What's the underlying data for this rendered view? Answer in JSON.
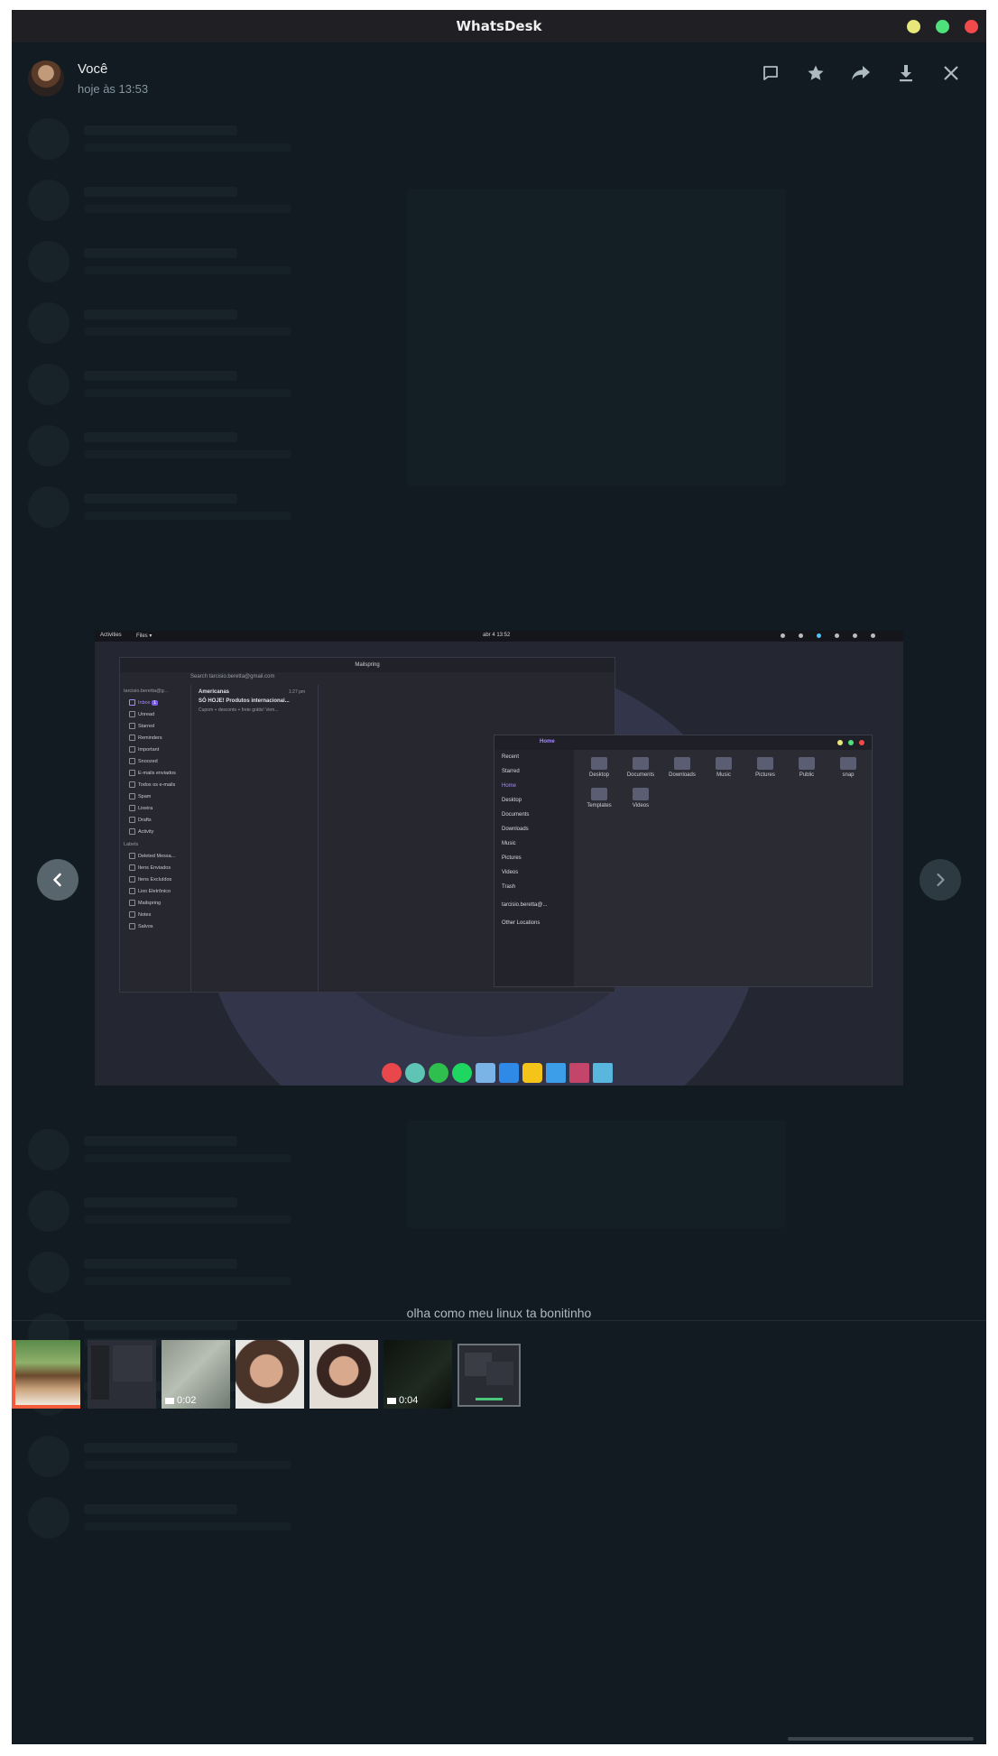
{
  "app": {
    "title": "WhatsDesk",
    "window_buttons": {
      "minimize_color": "#e8e87a",
      "maximize_color": "#4ee07a",
      "close_color": "#f24a4a"
    }
  },
  "header": {
    "sender_name": "Você",
    "timestamp": "hoje às 13:53",
    "actions": [
      "message-icon",
      "star-icon",
      "forward-icon",
      "download-icon",
      "close-icon"
    ]
  },
  "viewer": {
    "caption": "olha como meu linux ta bonitinho",
    "nav": {
      "prev": "chevron-left-icon",
      "next": "chevron-right-icon"
    }
  },
  "screenshot": {
    "topbar": {
      "activities": "Activities",
      "files_menu": "Files ▾",
      "clock": "abr 4  13:52"
    },
    "mailspring": {
      "title": "Mailspring",
      "search_placeholder": "Search tarcisio.beretta@gmail.com",
      "account": "tarcisio.beretta@g...",
      "folders": [
        "Inbox",
        "Unread",
        "Starred",
        "Reminders",
        "Important",
        "Snoozed",
        "E-mails enviados",
        "Todos os e-mails",
        "Spam",
        "Lixeira",
        "Drafts",
        "Activity"
      ],
      "inbox_count": "1",
      "labels_header": "Labels",
      "labels": [
        "Deleted Messa...",
        "Itens Enviados",
        "Itens Excluídos",
        "Lixo Eletrônico",
        "Mailspring",
        "Notes",
        "Salvos"
      ],
      "message": {
        "sender": "Americanas",
        "time": "1:27 pm",
        "subject": "SÓ HOJE! Produtos internacionai...",
        "preview": "Cupom + desconto + frete grátis! Vem..."
      }
    },
    "files": {
      "location": "Home",
      "sidebar": [
        "Recent",
        "Starred",
        "Home",
        "Desktop",
        "Documents",
        "Downloads",
        "Music",
        "Pictures",
        "Videos",
        "Trash",
        "tarcisio.beretta@...",
        "Other Locations"
      ],
      "folders": [
        "Desktop",
        "Documents",
        "Downloads",
        "Music",
        "Pictures",
        "Public",
        "snap",
        "Templates",
        "Videos"
      ]
    },
    "dock_colors": [
      "#e9474b",
      "#5ec5b5",
      "#2fbf4e",
      "#1ed760",
      "#7ab3e6",
      "#2e8ae6",
      "#f4c518",
      "#3c9ee8",
      "#c4456a",
      "#59b6dc"
    ]
  },
  "thumbnails": [
    {
      "kind": "image",
      "label": "dog photo",
      "duration": ""
    },
    {
      "kind": "image",
      "label": "dark screenshot",
      "duration": ""
    },
    {
      "kind": "video",
      "label": "blurry video",
      "duration": "0:02"
    },
    {
      "kind": "image",
      "label": "selfie",
      "duration": ""
    },
    {
      "kind": "image",
      "label": "selfie 2",
      "duration": ""
    },
    {
      "kind": "video",
      "label": "dark video",
      "duration": "0:04"
    },
    {
      "kind": "image",
      "label": "desktop screenshot",
      "duration": ""
    }
  ],
  "colors": {
    "background": "#111b21",
    "accent_selected": "#f15c3a",
    "purple": "#a78bfa"
  }
}
